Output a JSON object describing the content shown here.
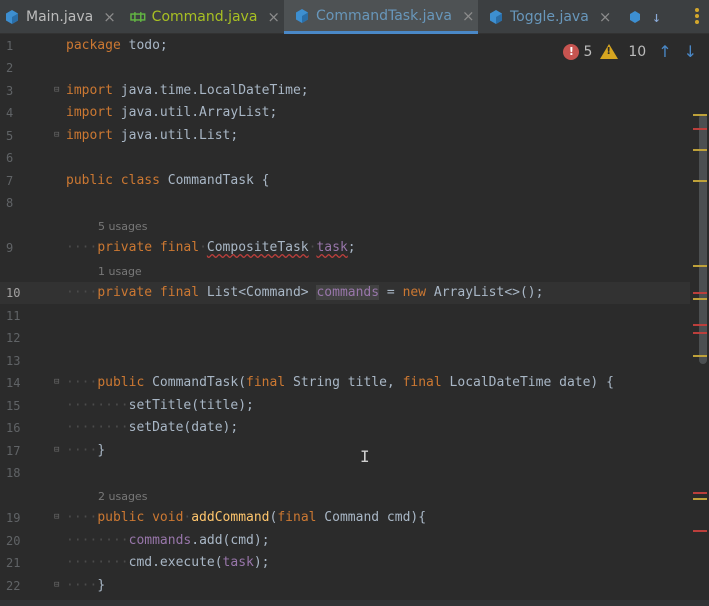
{
  "tabs": [
    {
      "label": "Main.java",
      "icon": "java-class-icon",
      "close": "×"
    },
    {
      "label": "Command.java",
      "icon": "java-interface-icon",
      "close": "×"
    },
    {
      "label": "CommandTask.java",
      "icon": "java-class-icon",
      "close": "×",
      "active": true
    },
    {
      "label": "Toggle.java",
      "icon": "java-class-icon",
      "close": "×"
    }
  ],
  "inspection": {
    "errors": "5",
    "warnings": "10"
  },
  "line_numbers": [
    "1",
    "2",
    "3",
    "4",
    "5",
    "6",
    "7",
    "8",
    "9",
    "10",
    "11",
    "12",
    "13",
    "14",
    "15",
    "16",
    "17",
    "18",
    "19",
    "20",
    "21",
    "22"
  ],
  "current_line": "10",
  "hints": {
    "h1": "5 usages",
    "h2": "1 usage",
    "h3": "2 usages"
  },
  "code": {
    "l1a": "package",
    "l1b": " todo;",
    "l3a": "import",
    "l3b": " java.time.LocalDateTime;",
    "l4a": "import",
    "l4b": " java.util.ArrayList;",
    "l5a": "import",
    "l5b": " java.util.List;",
    "l7a": "public class",
    "l7b": " CommandTask {",
    "l9a": "private final",
    "l9b": "CompositeTask",
    "l9c": "task",
    "l10a": "private final",
    "l10b": " List<Command> ",
    "l10c": "commands",
    "l10d": " = ",
    "l10e": "new",
    "l10f": " ArrayList<>();",
    "l14a": "public",
    "l14b": " CommandTask(",
    "l14c": "final",
    "l14d": " String title, ",
    "l14e": "final",
    "l14f": " LocalDateTime date) {",
    "l15": "setTitle(title);",
    "l16": "setDate(date);",
    "l17": "}",
    "l19a": "public void",
    "l19b": "addCommand",
    "l19c": "(",
    "l19d": "final",
    "l19e": " Command cmd){",
    "l20a": "commands",
    "l20b": ".add(cmd);",
    "l21a": "cmd.execute(",
    "l21b": "task",
    "l21c": ");",
    "l22": "}"
  }
}
